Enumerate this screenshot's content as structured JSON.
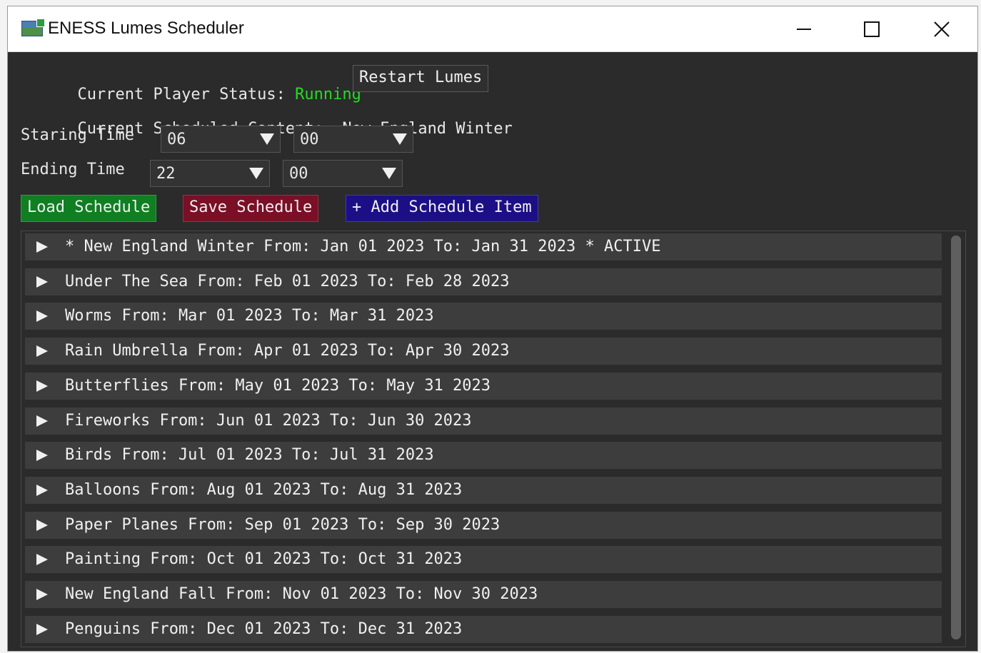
{
  "window": {
    "title": "ENESS Lumes Scheduler",
    "icon": "app-icon"
  },
  "status": {
    "label": "Current Player Status:",
    "value": "Running",
    "value_color": "#22dd22",
    "restart_label": "Restart Lumes"
  },
  "scheduled": {
    "label": "Current Scheduled Content:",
    "value": "New England Winter"
  },
  "starting_time": {
    "label": "Staring Time",
    "hour": "06",
    "minute": "00"
  },
  "ending_time": {
    "label": "Ending Time",
    "hour": "22",
    "minute": "00"
  },
  "actions": {
    "load_label": "Load Schedule",
    "save_label": "Save Schedule",
    "add_label": "+ Add Schedule Item"
  },
  "schedule_items": [
    "* New England Winter From: Jan 01 2023 To: Jan 31 2023 * ACTIVE",
    "Under The Sea From: Feb 01 2023 To: Feb 28 2023",
    "Worms From: Mar 01 2023 To: Mar 31 2023",
    "Rain Umbrella From: Apr 01 2023 To: Apr 30 2023",
    "Butterflies From: May 01 2023 To: May 31 2023",
    "Fireworks From: Jun 01 2023 To: Jun 30 2023",
    "Birds From: Jul 01 2023 To: Jul 31 2023",
    "Balloons From: Aug 01 2023 To: Aug 31 2023",
    "Paper Planes From: Sep 01 2023 To: Sep 30 2023",
    "Painting From: Oct 01 2023 To: Oct 31 2023",
    "New England Fall From: Nov 01 2023 To: Nov 30 2023",
    "Penguins From: Dec 01 2023 To: Dec 31 2023"
  ],
  "colors": {
    "load": "#0f7f22",
    "save": "#7a0f26",
    "add": "#1c0f86",
    "background": "#2b2b2b"
  }
}
